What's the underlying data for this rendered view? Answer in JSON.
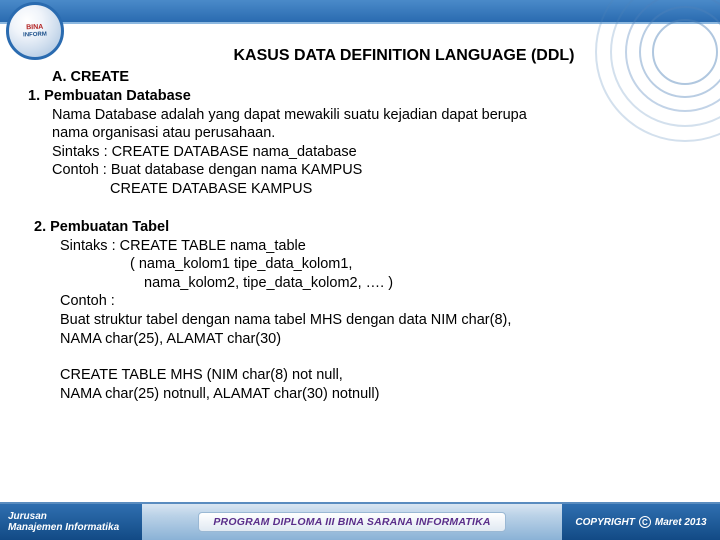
{
  "logo": {
    "line1": "BINA",
    "line2": "INFORM"
  },
  "title": "KASUS DATA DEFINITION LANGUAGE (DDL)",
  "secA": "A. CREATE",
  "sec1": "1. Pembuatan Database",
  "p1a": "Nama Database adalah yang dapat mewakili suatu kejadian dapat berupa",
  "p1b": "nama organisasi atau perusahaan.",
  "syn1": "Sintaks :  CREATE DATABASE  nama_database",
  "ex1a": "Contoh :  Buat database dengan nama KAMPUS",
  "ex1b": "CREATE DATABASE KAMPUS",
  "sec2": "2. Pembuatan Tabel",
  "syn2": "Sintaks : CREATE TABLE  nama_table",
  "par1": "( nama_kolom1 tipe_data_kolom1,",
  "par2": "nama_kolom2, tipe_data_kolom2, …. )",
  "ex2label": "Contoh :",
  "ex2a": "Buat struktur tabel dengan nama tabel MHS dengan data NIM char(8),",
  "ex2b": "NAMA char(25), ALAMAT char(30)",
  "ct1": "CREATE TABLE MHS  (NIM char(8) not null,",
  "ct2": "NAMA char(25) notnull,  ALAMAT char(30) notnull)",
  "footer": {
    "left1": "Jurusan",
    "left2": "Manajemen Informatika",
    "center": "PROGRAM DIPLOMA III BINA SARANA INFORMATIKA",
    "right_label": "COPYRIGHT",
    "right_date": "Maret 2013"
  }
}
